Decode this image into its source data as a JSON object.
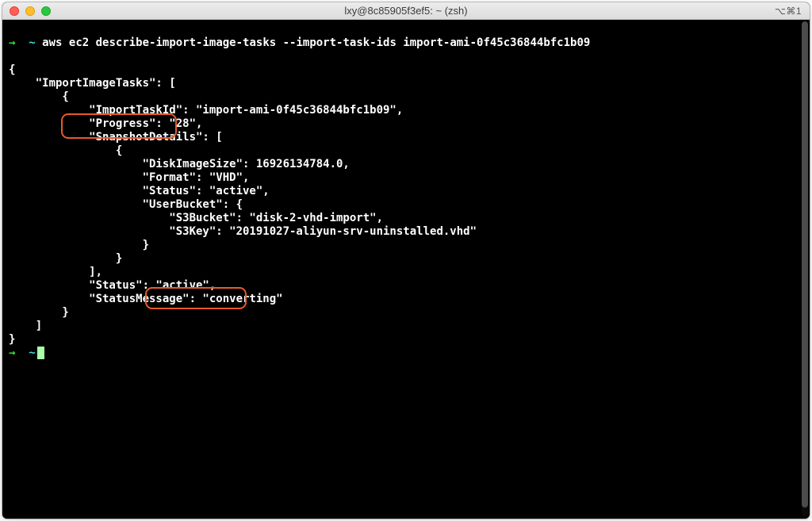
{
  "titlebar": {
    "title": "lxy@8c85905f3ef5: ~ (zsh)",
    "right": "⌥⌘1"
  },
  "prompt": {
    "arrow": "→",
    "tilde": "~"
  },
  "command": "aws ec2 describe-import-image-tasks --import-task-ids import-ami-0f45c36844bfc1b09",
  "output_lines": [
    "{",
    "    \"ImportImageTasks\": [",
    "        {",
    "            \"ImportTaskId\": \"import-ami-0f45c36844bfc1b09\",",
    "            \"Progress\": \"28\",",
    "            \"SnapshotDetails\": [",
    "                {",
    "                    \"DiskImageSize\": 16926134784.0,",
    "                    \"Format\": \"VHD\",",
    "                    \"Status\": \"active\",",
    "                    \"UserBucket\": {",
    "                        \"S3Bucket\": \"disk-2-vhd-import\",",
    "                        \"S3Key\": \"20191027-aliyun-srv-uninstalled.vhd\"",
    "                    }",
    "                }",
    "            ],",
    "            \"Status\": \"active\",",
    "            \"StatusMessage\": \"converting\"",
    "        }",
    "    ]",
    "}"
  ]
}
